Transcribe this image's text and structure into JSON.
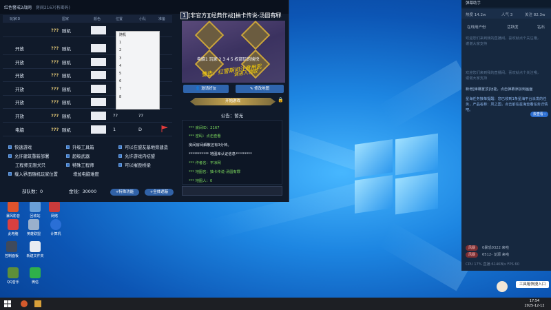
{
  "game": {
    "title": "红色警戒2战网",
    "room": "房间2167(有密码)",
    "columns": [
      "玩家ID",
      "国家",
      "颜色",
      "位置",
      "小队",
      "准备"
    ],
    "rows": [
      {
        "status": "",
        "country": "???",
        "type": "随机",
        "v1": "",
        "v2": "",
        "flag": false
      },
      {
        "status": "开放",
        "country": "???",
        "type": "随机",
        "v1": "",
        "v2": "",
        "flag": false
      },
      {
        "status": "开放",
        "country": "???",
        "type": "随机",
        "v1": "",
        "v2": "",
        "flag": false
      },
      {
        "status": "开放",
        "country": "???",
        "type": "随机",
        "v1": "",
        "v2": "",
        "flag": false
      },
      {
        "status": "开放",
        "country": "???",
        "type": "随机",
        "v1": "",
        "v2": "",
        "flag": false
      },
      {
        "status": "开放",
        "country": "???",
        "type": "随机",
        "v1": "",
        "v2": "",
        "flag": false
      },
      {
        "status": "开放",
        "country": "???",
        "type": "随机",
        "v1": "??",
        "v2": "??",
        "flag": false
      },
      {
        "status": "电脑",
        "country": "???",
        "type": "随机",
        "v1": "1",
        "v2": "D",
        "flag": true
      }
    ],
    "dropdown": [
      "随机",
      "1",
      "2",
      "3",
      "4",
      "5",
      "6",
      "7",
      "8"
    ],
    "options": [
      {
        "label": "快速游戏",
        "checked": true
      },
      {
        "label": "升级工具箱",
        "checked": true
      },
      {
        "label": "可以在盟友基地旁建造",
        "checked": true
      },
      {
        "label": "允许建筑重新部署",
        "checked": true
      },
      {
        "label": "超级武器",
        "checked": true
      },
      {
        "label": "允许游戏内结盟",
        "checked": true
      },
      {
        "label": "工程师无限犬只",
        "checked": false
      },
      {
        "label": "特殊工程师",
        "checked": true
      },
      {
        "label": "可以摧毁桥梁",
        "checked": true
      },
      {
        "label": "载入界面随机玩家位置",
        "checked": true
      },
      {
        "label": "增加电脑难度",
        "checked": false
      }
    ],
    "units": "部队数：0",
    "money": "金钱：30000",
    "special_btn": "+特殊功能",
    "shield_btn": "+全体遮蔽",
    "map_title": "[非官方][经典作战]抽卡传说-汤圆有罪",
    "map_label": "电脑1 玩家 2 3 4 5 权部玩的愉快",
    "map_overlay1": "警告，红警期间注意用武",
    "map_overlay2": "请进入领取",
    "invite_btn": "邀请好友",
    "change_map_btn": "修改地图",
    "start_btn": "开始游戏",
    "notice": "公告：暂无",
    "log": [
      {
        "text": "*** 房间ID：2167",
        "color": "#7edc5e"
      },
      {
        "text": "*** 密码：点击查看",
        "color": "#7edc5e"
      },
      {
        "text": "房间房间解散还有3分钟。",
        "color": "#e6edf7"
      },
      {
        "text": "*********** 地图库认证信息*********",
        "color": "#e6edf7"
      },
      {
        "text": "*** 作者名：平凉网",
        "color": "#7edc5e"
      },
      {
        "text": "*** 地图名：抽卡传说-汤圆有罪",
        "color": "#7edc5e"
      },
      {
        "text": "*** 地图人：0",
        "color": "#7edc5e"
      }
    ]
  },
  "assistant": {
    "title": "弹幕助手",
    "hot": "热度 14.2w",
    "people": "人气 3",
    "followers": "关注 82.3w",
    "tabs": [
      "在线用户份",
      "活跃度",
      "钻石"
    ],
    "msgs": [
      {
        "text": "欢迎您们来到我的直播间，喜欢就点个关注哦，谢谢大家支持",
        "color": "#5f7896"
      },
      {
        "text": "欢迎您们来到我的直播间，喜欢就点个关注哦，谢谢大家支持",
        "color": "#5f7896"
      },
      {
        "text": "新增[弹幕置顶]功能，点击弹幕添加到画面",
        "color": "#a9c5e8"
      },
      {
        "text": "星海任务接单提醒：您已收到1条星海平台派发的任务，产品名称：风之国，点击前往星海查看任务详情吧。",
        "color": "#8fb8f0"
      }
    ],
    "goto": "去查看 ›",
    "entries": [
      {
        "badge": "风暴",
        "text": "0暴恐0322 来啦"
      },
      {
        "badge": "风暴",
        "text": "6512- 龙源 来啦"
      }
    ],
    "status": "CPU 17%  直播 614KB/s FPS 60"
  },
  "desktop_icons": [
    "暴风影音",
    "回收站",
    "网络",
    "此电脑",
    "英雄联盟",
    "计算机",
    "控制面板",
    "新建文件夹",
    "QQ音乐",
    "微信"
  ],
  "taskbar": {
    "time": "17:54",
    "date": "2025-12-12"
  },
  "popup": "工具箱快捷入口"
}
